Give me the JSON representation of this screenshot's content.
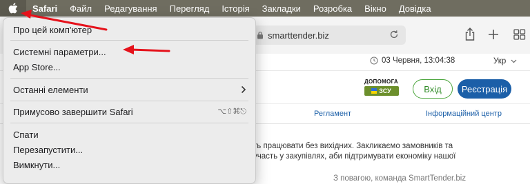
{
  "menubar": {
    "items": [
      "Safari",
      "Файл",
      "Редагування",
      "Перегляд",
      "Історія",
      "Закладки",
      "Розробка",
      "Вікно",
      "Довідка"
    ]
  },
  "toolbar": {
    "url": "smarttender.biz"
  },
  "page": {
    "date": "03 Червня, 13:04:38",
    "lang": "Укр",
    "help_title": "ДОПОМОГА",
    "help_badge": "ЗСУ",
    "login": "Вхід",
    "register": "Реєстрація",
    "nav_reglament": "Регламент",
    "nav_info": "Інформаційний центр",
    "text_line1": "ть працювати без вихідних. Закликаємо замовників та",
    "text_line2": "участь у закупівлях, аби підтримувати економіку нашої",
    "text_line3": "З повагою, команда SmartTender.biz"
  },
  "apple_menu": {
    "about": "Про цей комп'ютер",
    "settings": "Системні параметри...",
    "app_store": "App Store...",
    "recent": "Останні елементи",
    "force_quit": "Примусово завершити Safari",
    "force_quit_shortcut": "⌥⇧⌘⎋",
    "sleep": "Спати",
    "restart": "Перезапустити...",
    "shutdown": "Вимкнути..."
  },
  "colors": {
    "menubar": "#6f6d60",
    "annotation_arrow": "#e5121b",
    "login_green": "#4ba53c",
    "register_blue": "#1b5fa8"
  },
  "icons": [
    "apple-icon",
    "lock-icon",
    "reload-icon",
    "share-icon",
    "new-tab-icon",
    "tab-overview-icon",
    "clock-icon",
    "chevron-down-icon",
    "chevron-right-icon"
  ]
}
